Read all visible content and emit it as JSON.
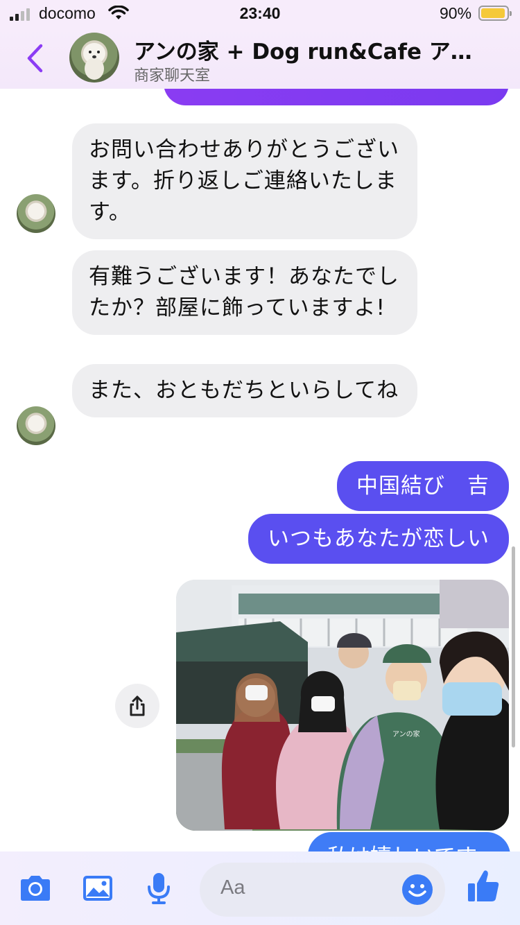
{
  "status_bar": {
    "carrier": "docomo",
    "time": "23:40",
    "battery_pct": "90%"
  },
  "header": {
    "title": "アンの家 + Dog run&Cafe ア…",
    "subtitle": "商家聊天室"
  },
  "messages": [
    {
      "side": "in",
      "text": "お問い合わせありがとうございます。折り返しご連絡いたします。"
    },
    {
      "side": "in",
      "text": "有難うございます！あなたでしたか？部屋に飾っていますよ!"
    },
    {
      "side": "in",
      "text": "また、おともだちといらしてね"
    },
    {
      "side": "out",
      "text": "中国結び　吉"
    },
    {
      "side": "out",
      "text": "いつもあなたが恋しい"
    },
    {
      "side": "out",
      "type": "photo",
      "sign_text": "アンの家"
    },
    {
      "side": "out",
      "text": "私は嬉しいです"
    }
  ],
  "composer": {
    "placeholder": "Aa"
  },
  "colors": {
    "accent": "#8b3cf4",
    "outgoing_bubble": "#5a4ff0",
    "incoming_bubble": "#eeeef0",
    "icon_blue": "#3a7bf6"
  },
  "icons": [
    "back-chevron-icon",
    "camera-icon",
    "gallery-icon",
    "microphone-icon",
    "emoji-icon",
    "thumbs-up-icon",
    "share-icon",
    "wifi-icon",
    "battery-icon"
  ]
}
